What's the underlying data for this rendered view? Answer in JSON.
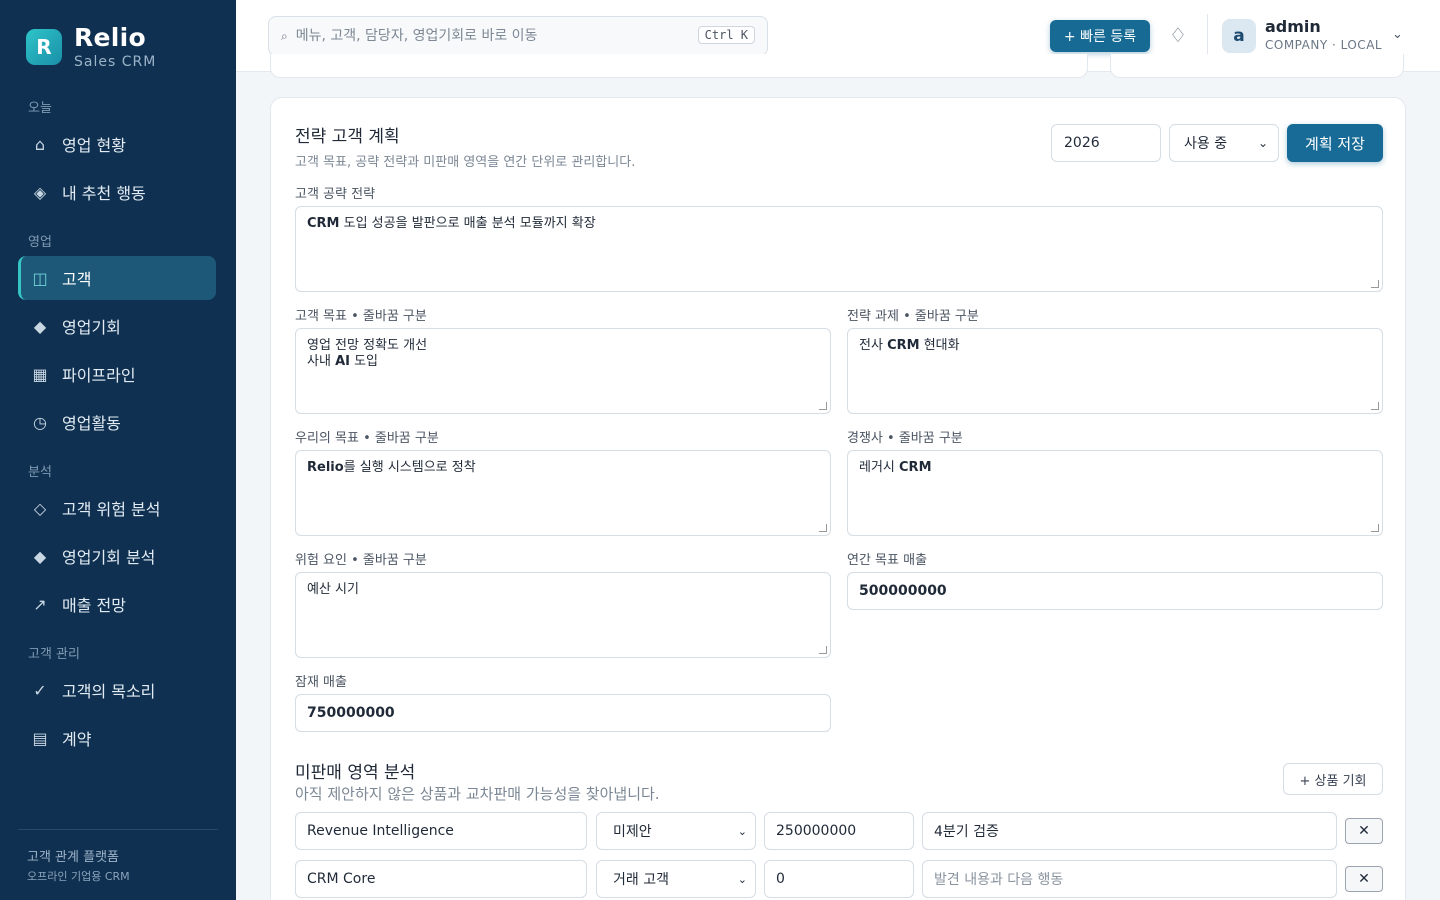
{
  "brand": {
    "name": "Relio",
    "sub": "Sales CRM",
    "logo_letter": "R"
  },
  "sidebar": {
    "sections": [
      {
        "label": "오늘"
      },
      {
        "label": "영업"
      },
      {
        "label": "분석"
      },
      {
        "label": "고객 관리"
      }
    ],
    "items": [
      {
        "label": "영업 현황",
        "icon": "home-icon",
        "glyph": "⌂"
      },
      {
        "label": "내 추천 행동",
        "icon": "diamond-icon",
        "glyph": "◈"
      },
      {
        "label": "고객",
        "icon": "columns-icon",
        "glyph": "◫",
        "active": true
      },
      {
        "label": "영업기회",
        "icon": "diamond-filled-icon",
        "glyph": "◆"
      },
      {
        "label": "파이프라인",
        "icon": "grid-icon",
        "glyph": "▦"
      },
      {
        "label": "영업활동",
        "icon": "clock-icon",
        "glyph": "◷"
      },
      {
        "label": "고객 위험 분석",
        "icon": "diamond-outline-icon",
        "glyph": "◇"
      },
      {
        "label": "영업기회 분석",
        "icon": "diamond-filled-icon",
        "glyph": "◆"
      },
      {
        "label": "매출 전망",
        "icon": "trend-arrow-icon",
        "glyph": "↗"
      },
      {
        "label": "고객의 목소리",
        "icon": "check-icon",
        "glyph": "✓"
      },
      {
        "label": "계약",
        "icon": "document-icon",
        "glyph": "▤"
      }
    ],
    "footer": {
      "line1": "고객 관계 플랫폼",
      "line2": "오프라인 기업용 CRM"
    }
  },
  "topbar": {
    "search_placeholder": "메뉴, 고객, 담당자, 영업기회로 바로 이동",
    "search_icon": "⌕",
    "shortcut": "Ctrl K",
    "quick_add": "+ 빠른 등록",
    "bell_glyph": "♢",
    "user": {
      "initial": "a",
      "name": "admin",
      "sub": "COMPANY · LOCAL"
    },
    "chevron": "⌄"
  },
  "plan": {
    "title": "전략 고객 계획",
    "desc": "고객 목표, 공략 전략과 미판매 영역을 연간 단위로 관리합니다.",
    "year": "2026",
    "status": "사용 중",
    "save": "계획 저장",
    "fields": {
      "strategy_label": "고객 공략 전략",
      "strategy_value": "CRM 도입 성공을 발판으로 매출 분석 모듈까지 확장",
      "cust_goal_label": "고객 목표 • 줄바꿈 구분",
      "cust_goal_value": "영업 전망 정확도 개선\n사내 AI 도입",
      "task_label": "전략 과제 • 줄바꿈 구분",
      "task_value": "전사 CRM 현대화",
      "our_goal_label": "우리의 목표 • 줄바꿈 구분",
      "our_goal_value": "Relio를 실행 시스템으로 정착",
      "competitor_label": "경쟁사 • 줄바꿈 구분",
      "competitor_value": "레거시 CRM",
      "risk_label": "위험 요인 • 줄바꿈 구분",
      "risk_value": "예산 시기",
      "annual_label": "연간 목표 매출",
      "annual_value": "500000000",
      "potential_label": "잠재 매출",
      "potential_value": "750000000"
    },
    "whitespace": {
      "title": "미판매 영역 분석",
      "desc": "아직 제안하지 않은 상품과 교차판매 가능성을 찾아냅니다.",
      "add": "+ 상품 기회",
      "note_placeholder": "발견 내용과 다음 행동",
      "delete_glyph": "✕",
      "caret_glyph": "⌄",
      "rows": [
        {
          "product": "Revenue Intelligence",
          "status": "미제안",
          "amount": "250000000",
          "note": "4분기 검증"
        },
        {
          "product": "CRM Core",
          "status": "거래 고객",
          "amount": "0",
          "note": ""
        }
      ]
    }
  }
}
